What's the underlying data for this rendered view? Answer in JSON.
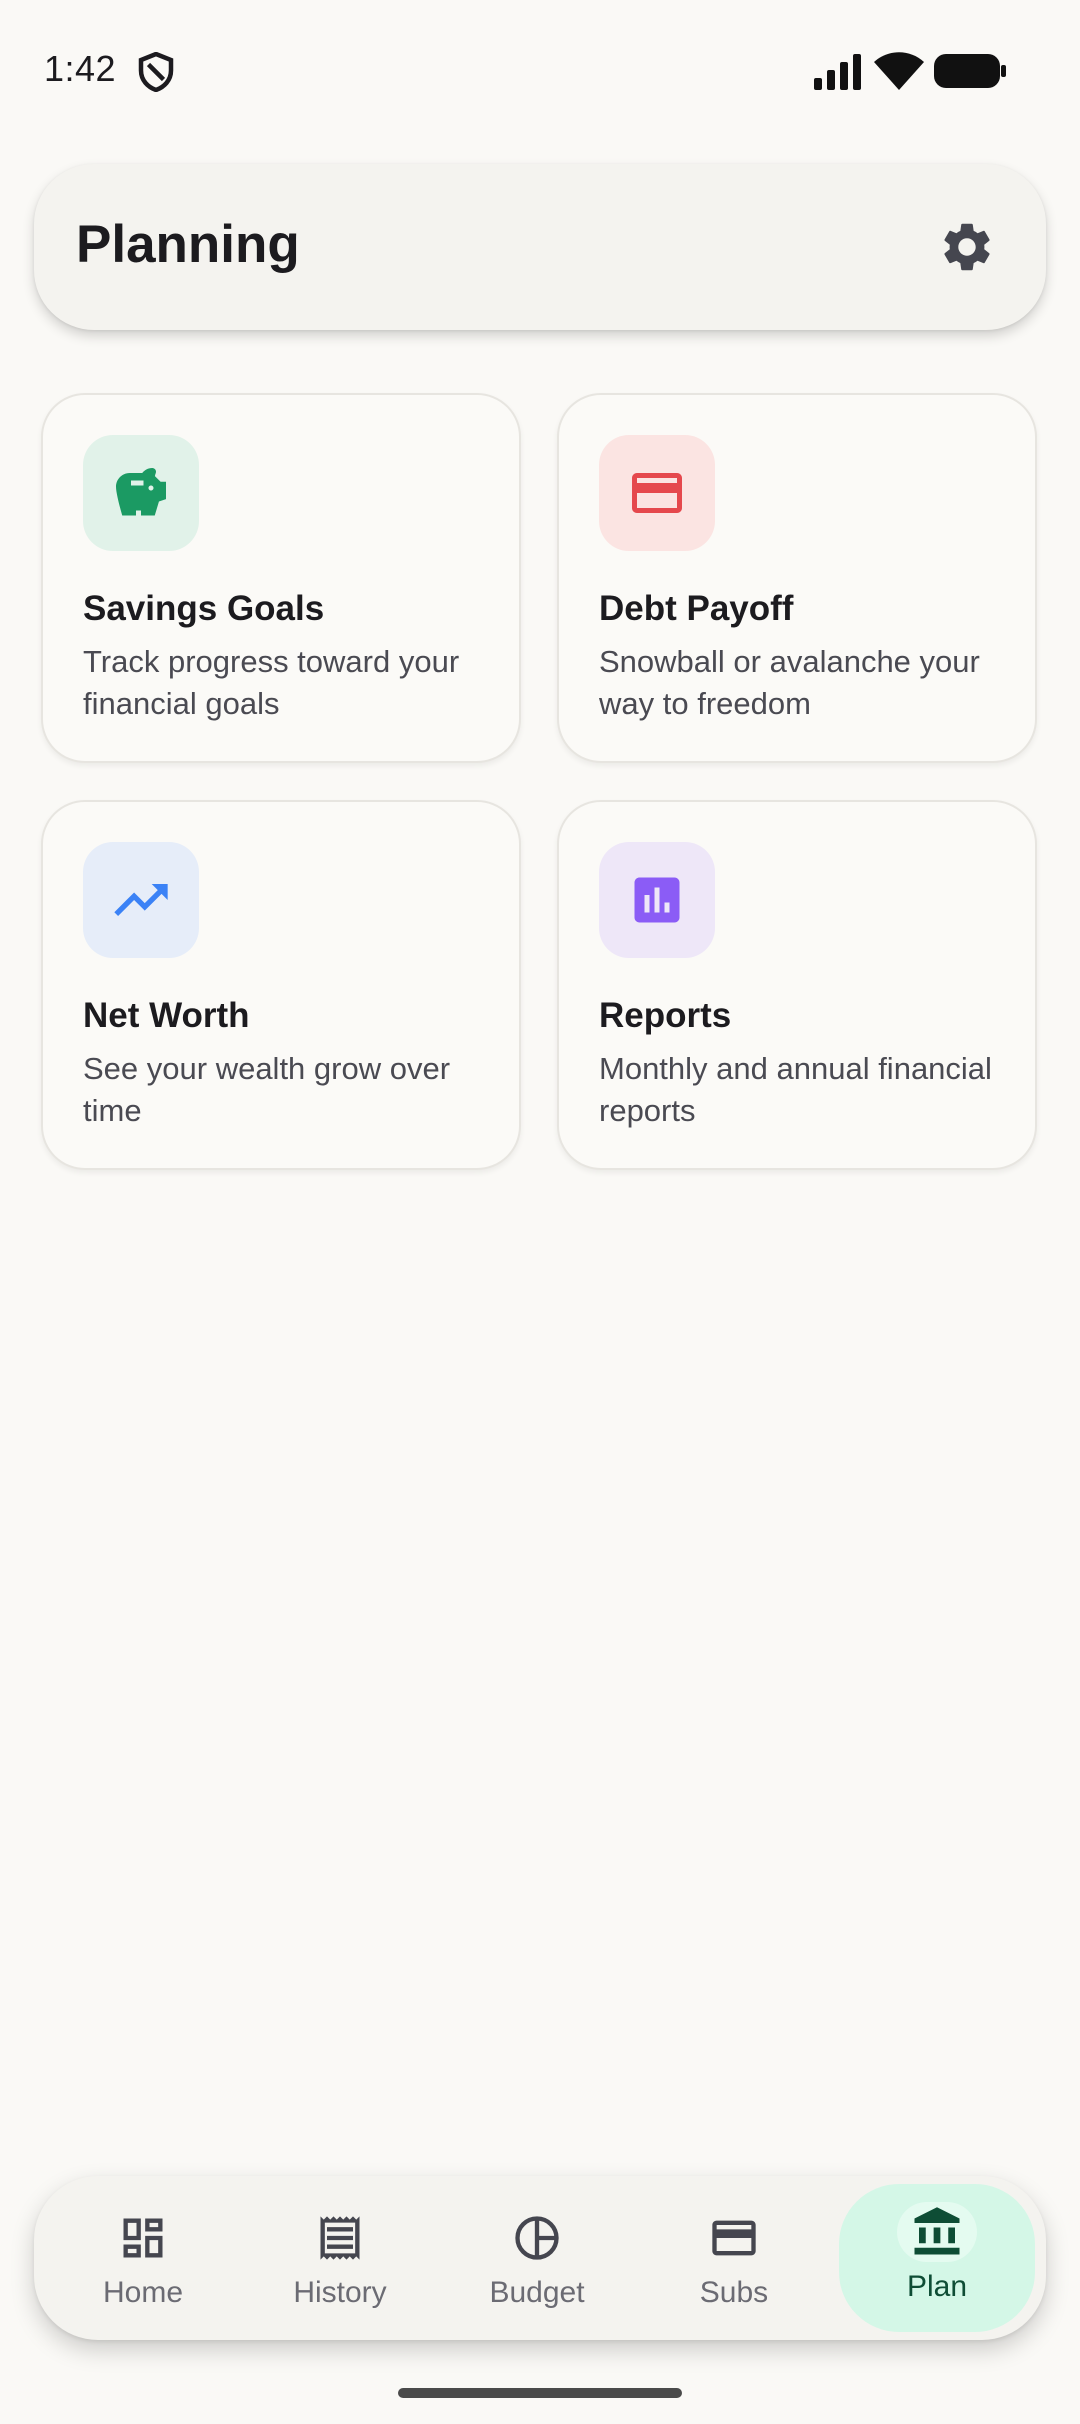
{
  "status_bar": {
    "time": "1:42"
  },
  "header": {
    "title": "Planning"
  },
  "cards": [
    {
      "title": "Savings Goals",
      "description": "Track progress toward your financial goals",
      "icon": "piggy-bank-icon",
      "color": "#1B9A63",
      "bg": "#E1F2E9"
    },
    {
      "title": "Debt Payoff",
      "description": "Snowball or avalanche your way to freedom",
      "icon": "credit-card-icon",
      "color": "#E5484D",
      "bg": "#FBE4E2"
    },
    {
      "title": "Net Worth",
      "description": "See your wealth grow over time",
      "icon": "trending-up-icon",
      "color": "#3B82F6",
      "bg": "#E6EDF9"
    },
    {
      "title": "Reports",
      "description": "Monthly and annual financial reports",
      "icon": "bar-chart-icon",
      "color": "#8B5CF6",
      "bg": "#EEE7F8"
    }
  ],
  "nav": {
    "items": [
      {
        "label": "Home",
        "icon": "dashboard-icon"
      },
      {
        "label": "History",
        "icon": "receipt-icon"
      },
      {
        "label": "Budget",
        "icon": "pie-chart-icon"
      },
      {
        "label": "Subs",
        "icon": "credit-card-icon"
      },
      {
        "label": "Plan",
        "icon": "bank-icon"
      }
    ],
    "active": "Plan",
    "active_color": "#0E4D35"
  }
}
